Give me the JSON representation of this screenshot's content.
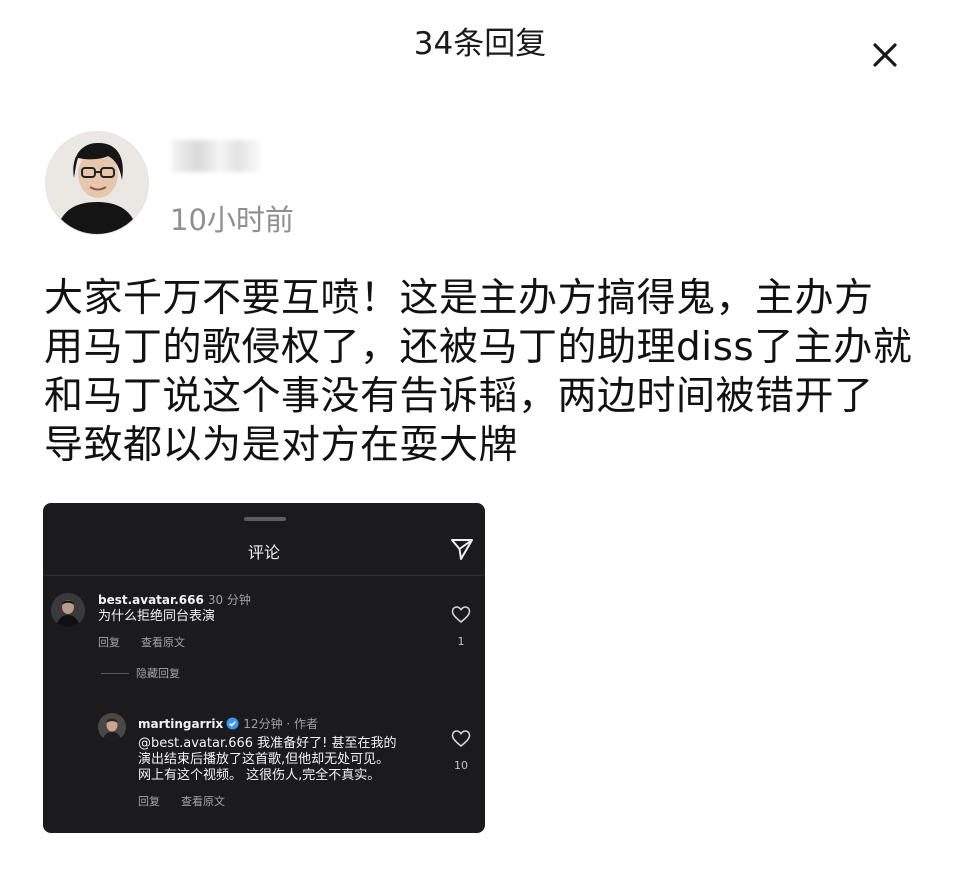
{
  "header": {
    "title": "34条回复"
  },
  "post": {
    "time": "10小时前",
    "lines": [
      "大家千万不要互喷！这是主办方搞得鬼，主办方",
      "用马丁的歌侵权了，还被马丁的助理diss了主办就",
      "和马丁说这个事没有告诉韬，两边时间被错开了",
      "导致都以为是对方在耍大牌"
    ]
  },
  "embed": {
    "title": "评论",
    "comments": [
      {
        "user": "best.avatar.666",
        "time": "30 分钟",
        "text": "为什么拒绝同台表演",
        "reply_label": "回复",
        "view_original_label": "查看原文",
        "likes": "1"
      }
    ],
    "hidden_replies_label": "隐藏回复",
    "reply": {
      "user": "martingarrix",
      "time": "12分钟 · 作者",
      "text_lines": [
        "@best.avatar.666 我准备好了! 甚至在我的",
        "演出结束后播放了这首歌,但他却无处可见。",
        "网上有这个视频。 这很伤人,完全不真实。"
      ],
      "reply_label": "回复",
      "view_original_label": "查看原文",
      "likes": "10"
    }
  },
  "colors": {
    "embed_bg": "#1b1b1d",
    "verified": "#3897f0",
    "timestamp": "#8f8f8f"
  },
  "icons": [
    "close-icon",
    "send-icon",
    "heart-icon",
    "verified-badge-icon"
  ]
}
